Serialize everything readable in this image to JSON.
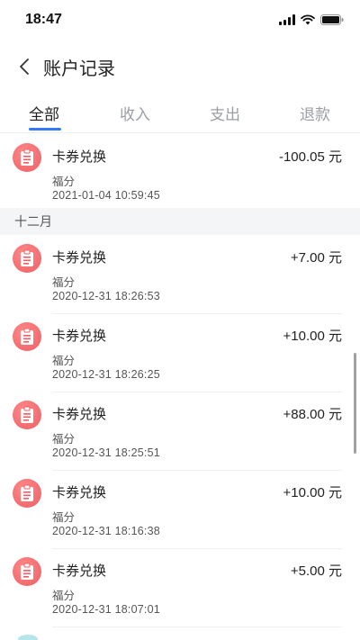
{
  "status": {
    "time": "18:47"
  },
  "nav": {
    "title": "账户记录"
  },
  "tabs": [
    {
      "label": "全部"
    },
    {
      "label": "收入"
    },
    {
      "label": "支出"
    },
    {
      "label": "退款"
    }
  ],
  "records_top": [
    {
      "title": "卡券兑换",
      "subtitle": "福分",
      "time": "2021-01-04 10:59:45",
      "amount": "-100.05 元"
    }
  ],
  "month_header": "十二月",
  "records_dec": [
    {
      "title": "卡券兑换",
      "subtitle": "福分",
      "time": "2020-12-31 18:26:53",
      "amount": "+7.00 元"
    },
    {
      "title": "卡券兑换",
      "subtitle": "福分",
      "time": "2020-12-31 18:26:25",
      "amount": "+10.00 元"
    },
    {
      "title": "卡券兑换",
      "subtitle": "福分",
      "time": "2020-12-31 18:25:51",
      "amount": "+88.00 元"
    },
    {
      "title": "卡券兑换",
      "subtitle": "福分",
      "time": "2020-12-31 18:16:38",
      "amount": "+10.00 元"
    },
    {
      "title": "卡券兑换",
      "subtitle": "福分",
      "time": "2020-12-31 18:07:01",
      "amount": "+5.00 元"
    }
  ],
  "colors": {
    "accent": "#3478f6",
    "record_icon": "#ef5d62",
    "section_bg": "#f4f5f7"
  },
  "icons": {
    "back": "chevron-left-icon",
    "record": "clipboard-icon"
  }
}
